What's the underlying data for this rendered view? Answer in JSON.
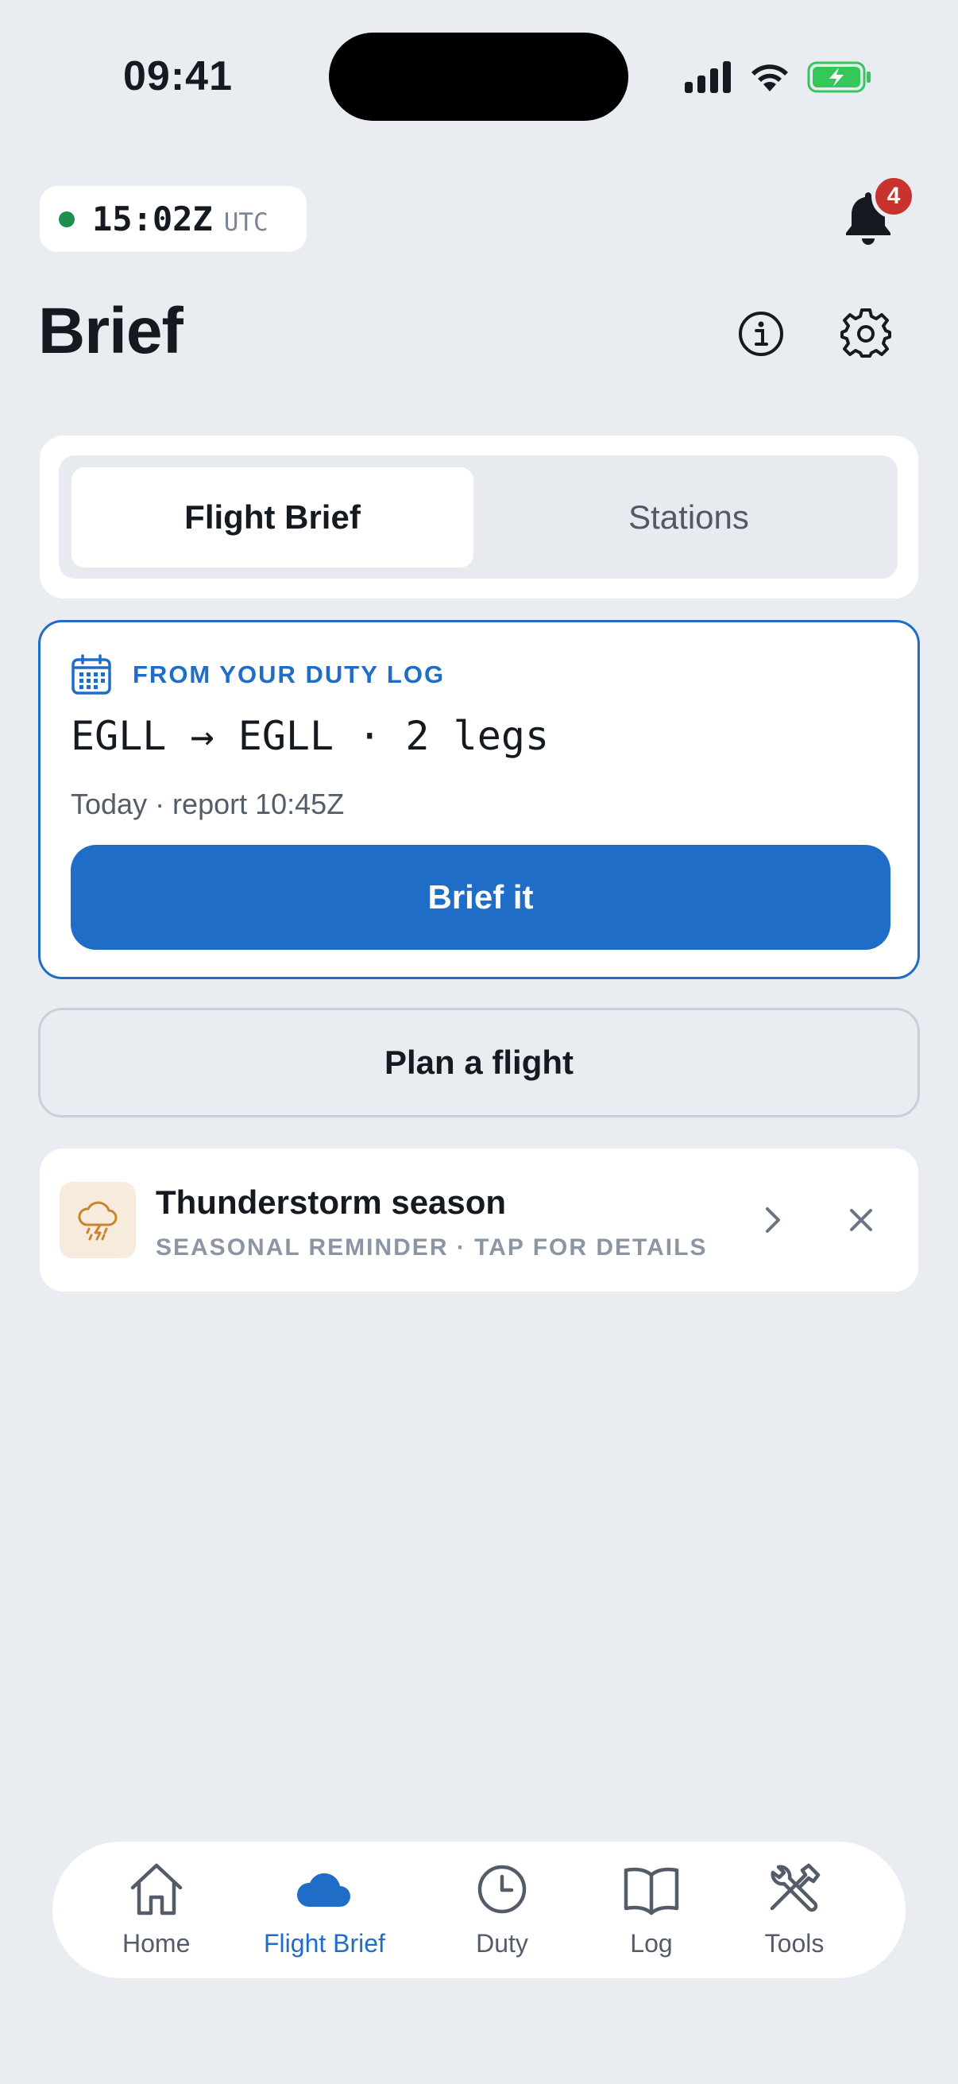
{
  "status_bar": {
    "time": "09:41",
    "icons": [
      "cellular-signal-icon",
      "wifi-icon",
      "battery-charging-icon"
    ]
  },
  "header": {
    "utc_time": "15:02Z",
    "utc_label": "UTC",
    "notification_count": "4",
    "title": "Brief"
  },
  "segmented": {
    "active": "Flight Brief",
    "inactive": "Stations"
  },
  "duty_card": {
    "label": "FROM YOUR DUTY LOG",
    "route": "EGLL → EGLL · 2 legs",
    "meta": "Today · report 10:45Z",
    "button": "Brief it"
  },
  "plan_button": "Plan a flight",
  "reminder": {
    "title": "Thunderstorm season",
    "subtitle": "SEASONAL REMINDER · TAP FOR DETAILS"
  },
  "tabbar": {
    "items": [
      {
        "label": "Home",
        "icon": "home-icon"
      },
      {
        "label": "Flight Brief",
        "icon": "cloud-icon",
        "active": true
      },
      {
        "label": "Duty",
        "icon": "clock-icon"
      },
      {
        "label": "Log",
        "icon": "book-icon"
      },
      {
        "label": "Tools",
        "icon": "tools-icon"
      }
    ]
  },
  "colors": {
    "accent": "#1f6dc6",
    "background": "#e9ecf1",
    "status_green": "#1f8f4e",
    "badge_red": "#c8322f",
    "reminder_amber": "#c9852e"
  }
}
